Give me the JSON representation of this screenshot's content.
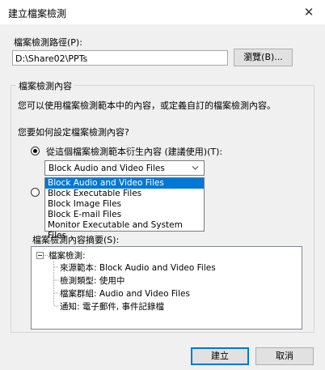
{
  "window": {
    "title": "建立檔案檢測",
    "close_glyph": "✕"
  },
  "path": {
    "label": "檔案檢測路徑(P):",
    "value": "D:\\Share02\\PPTs",
    "browse_label": "瀏覽(B)..."
  },
  "content_group": {
    "title": "檔案檢測內容",
    "description": "您可以使用檔案檢測範本中的內容，或定義自訂的檔案檢測內容。",
    "question": "您要如何設定檔案檢測內容?",
    "radio_template_label": "從這個檔案檢測範本衍生內容 (建議使用)(T):",
    "template_select": {
      "selected": "Block Audio and Video Files",
      "options": [
        "Block Audio and Video Files",
        "Block Executable Files",
        "Block Image Files",
        "Block E-mail Files",
        "Monitor Executable and System Files"
      ],
      "highlighted_index": 0
    },
    "summary_label": "檔案檢測內容摘要(S):",
    "summary_tree": {
      "root": "檔案檢測:",
      "items": [
        "來源範本: Block Audio and Video Files",
        "檢測類型: 使用中",
        "檔案群組: Audio and Video Files",
        "通知: 電子郵件, 事件記錄檔"
      ]
    }
  },
  "footer": {
    "create_label": "建立",
    "cancel_label": "取消"
  }
}
